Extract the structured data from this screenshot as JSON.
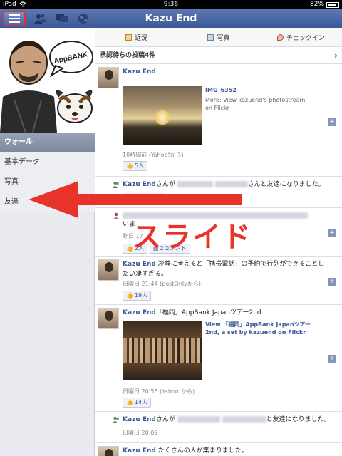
{
  "status_bar": {
    "carrier": "iPad",
    "time": "9:36",
    "battery": "82%"
  },
  "top_bar": {
    "title": "Kazu End",
    "icons": [
      "menu-icon",
      "friend-requests-icon",
      "messages-icon",
      "notifications-globe-icon"
    ]
  },
  "sidebar": {
    "profile_badge": "AppBANK",
    "items": [
      {
        "label": "ウォール",
        "active": true
      },
      {
        "label": "基本データ",
        "active": false
      },
      {
        "label": "写真",
        "active": false
      },
      {
        "label": "友達",
        "active": false
      }
    ]
  },
  "tabs": [
    {
      "label": "近況",
      "icon": "status-icon"
    },
    {
      "label": "写真",
      "icon": "photo-icon"
    },
    {
      "label": "チェックイン",
      "icon": "checkin-icon"
    }
  ],
  "pending": {
    "label": "承認待ちの投稿4件"
  },
  "posts": [
    {
      "author": "Kazu End",
      "link_title": "IMG_6352",
      "link_desc": "More: View kazuend's photostream on Flickr",
      "time": "10時間前 (Yahoo!から)",
      "likes": "5人"
    },
    {
      "author": "Kazu End",
      "text_pre": "さんが",
      "text_post": "さんと友達になりました。"
    },
    {
      "line1": "いま",
      "time": "昨日 17",
      "likes": "2人",
      "comments": "2コメント"
    },
    {
      "author": "Kazu End",
      "text": "冷静に考えると「携帯電話」の予約で行列ができることしたい凄すぎる。",
      "time": "日曜日 21:44 (postOnlyから)",
      "likes": "19人"
    },
    {
      "author": "Kazu End",
      "text": "「福岡」AppBank Japanツアー2nd",
      "link_title": "View 「福岡」AppBank Japanツアー2nd, a set by kazuend on Flickr",
      "time": "日曜日 20:55 (Yahoo!から)",
      "likes": "14人"
    },
    {
      "author": "Kazu End",
      "text_pre": "さんが",
      "text_post": "と友達になりました。",
      "time": "日曜日 20:09"
    },
    {
      "author": "Kazu End",
      "text": "たくさんの人が集まりました。"
    }
  ],
  "overlay": {
    "label": "スライド",
    "color": "#e8332b"
  },
  "colors": {
    "header": "#3b5998",
    "accent": "#e03131",
    "link": "#3b5998"
  }
}
